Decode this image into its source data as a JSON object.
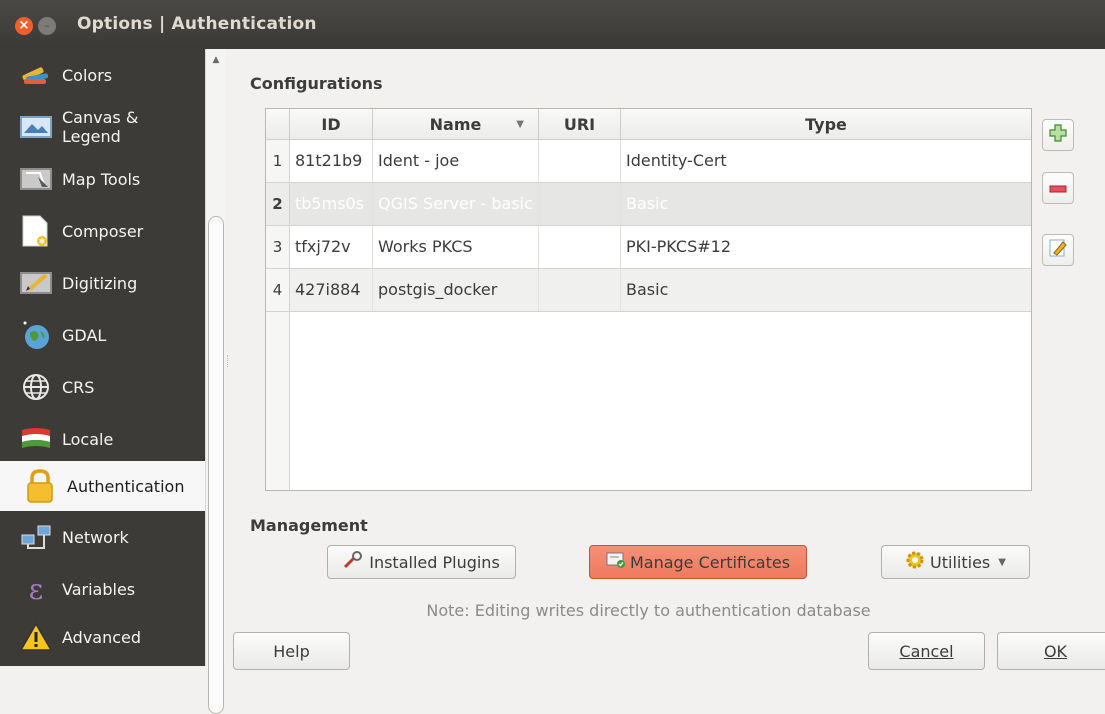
{
  "window": {
    "title": "Options | Authentication",
    "close_glyph": "×",
    "min_glyph": "–"
  },
  "sidebar": {
    "items": [
      {
        "label": "Colors",
        "icon": "colors-icon"
      },
      {
        "label": "Canvas &\nLegend",
        "icon": "canvas-legend-icon"
      },
      {
        "label": "Map Tools",
        "icon": "map-tools-icon"
      },
      {
        "label": "Composer",
        "icon": "composer-icon"
      },
      {
        "label": "Digitizing",
        "icon": "digitizing-icon"
      },
      {
        "label": "GDAL",
        "icon": "gdal-icon"
      },
      {
        "label": "CRS",
        "icon": "crs-icon"
      },
      {
        "label": "Locale",
        "icon": "locale-icon"
      },
      {
        "label": "Authentication",
        "icon": "lock-icon",
        "active": true
      },
      {
        "label": "Network",
        "icon": "network-icon"
      },
      {
        "label": "Variables",
        "icon": "variables-icon"
      },
      {
        "label": "Advanced",
        "icon": "warning-icon"
      }
    ]
  },
  "configurations": {
    "title": "Configurations",
    "columns": [
      "ID",
      "Name",
      "URI",
      "Type"
    ],
    "rows": [
      {
        "num": "1",
        "id": "81t21b9",
        "name": "Ident - joe",
        "uri": "",
        "type": "Identity-Cert"
      },
      {
        "num": "2",
        "id": "tb5ms0s",
        "name": "QGIS Server - basic",
        "uri": "",
        "type": "Basic",
        "selected": true
      },
      {
        "num": "3",
        "id": "tfxj72v",
        "name": "Works PKCS",
        "uri": "",
        "type": "PKI-PKCS#12"
      },
      {
        "num": "4",
        "id": "427i884",
        "name": "postgis_docker",
        "uri": "",
        "type": "Basic"
      }
    ]
  },
  "management": {
    "title": "Management",
    "installed_plugins": "Installed Plugins",
    "manage_certificates": "Manage Certificates",
    "utilities": "Utilities",
    "note": "Note: Editing writes directly to authentication database"
  },
  "footer": {
    "help": "Help",
    "cancel": "Cancel",
    "ok": "OK"
  },
  "colors": {
    "accent": "#ef7a5c",
    "titlebar": "#3b3a37",
    "sidebar": "#3c3b37",
    "close": "#f0602d"
  }
}
